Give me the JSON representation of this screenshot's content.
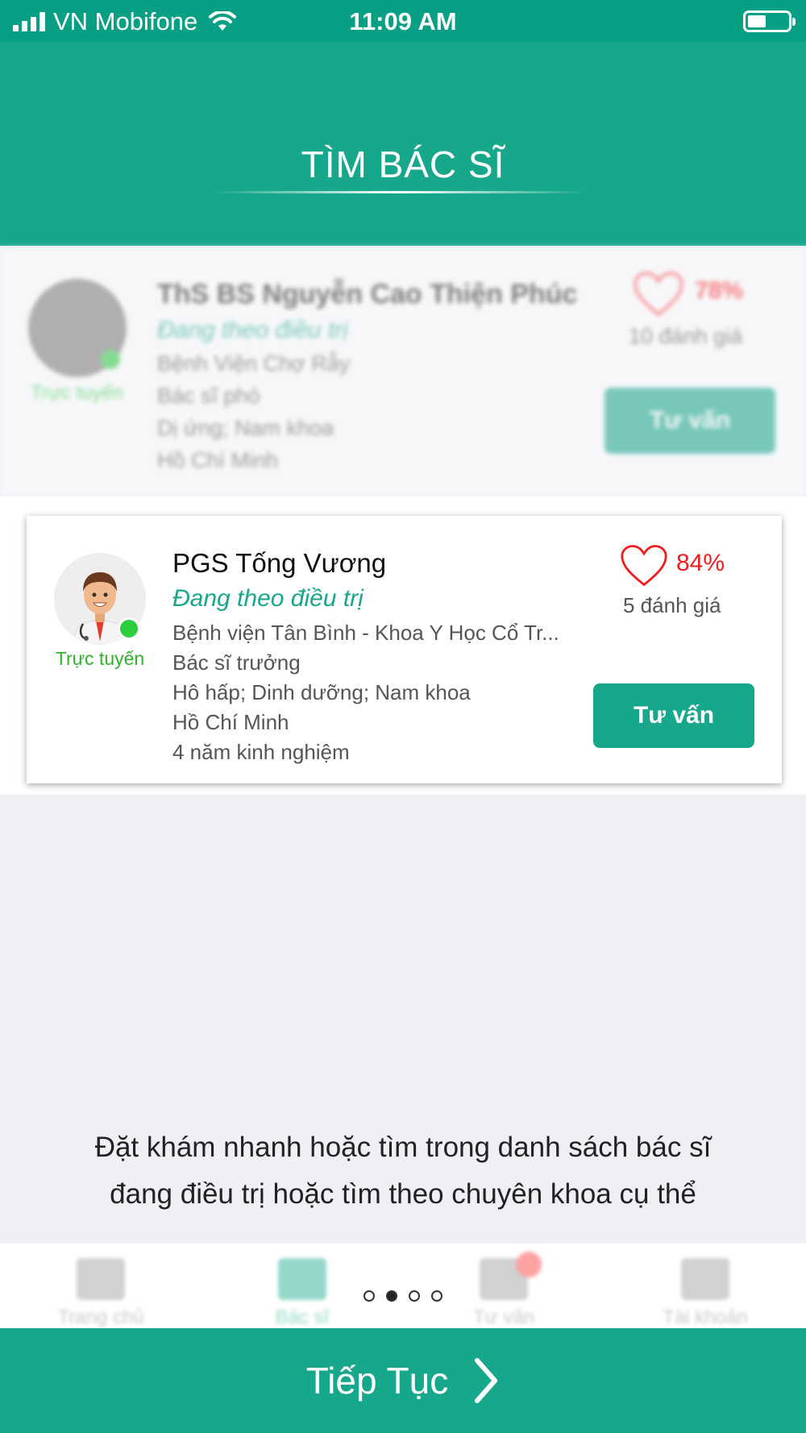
{
  "status_bar": {
    "carrier": "VN Mobifone",
    "time": "11:09 AM"
  },
  "header": {
    "title": "TÌM BÁC SĨ"
  },
  "background_card": {
    "name": "ThS BS Nguyễn Cao Thiện Phúc",
    "status": "Đang theo điều trị",
    "online_label": "Trực tuyến",
    "hospital": "Bệnh Viện Chợ Rẫy",
    "position": "Bác sĩ phó",
    "specialties": "Dị ứng; Nam khoa",
    "city": "Hồ Chí Minh",
    "rating": "78%",
    "reviews": "10 đánh giá",
    "consult_label": "Tư vấn"
  },
  "doctor_card": {
    "name": "PGS Tống Vương",
    "status": "Đang theo điều trị",
    "online_label": "Trực tuyến",
    "hospital": "Bệnh viện Tân Bình - Khoa Y Học Cổ Tr...",
    "position": "Bác sĩ trưởng",
    "specialties": "Hô hấp; Dinh dưỡng; Nam khoa",
    "city": "Hồ Chí Minh",
    "experience": "4 năm kinh nghiệm",
    "rating": "84%",
    "reviews": "5 đánh giá",
    "consult_label": "Tư vấn"
  },
  "description": {
    "line1": "Đặt khám nhanh hoặc tìm trong danh sách bác sĩ",
    "line2": "đang điều trị hoặc tìm theo chuyên khoa cụ thể"
  },
  "tab_bar": {
    "tabs": [
      {
        "label": "Trang chủ",
        "icon": "home-icon"
      },
      {
        "label": "Bác sĩ",
        "icon": "doctor-icon"
      },
      {
        "label": "Tư vấn",
        "icon": "chat-icon"
      },
      {
        "label": "Tài khoản",
        "icon": "account-icon"
      }
    ],
    "active_index": 1
  },
  "pagination": {
    "total": 4,
    "current": 2
  },
  "continue_button": {
    "label": "Tiếp Tục"
  },
  "colors": {
    "primary": "#17a88b",
    "status_bar": "#07a085",
    "online": "#2ecc40",
    "rating": "#f01d1d"
  }
}
